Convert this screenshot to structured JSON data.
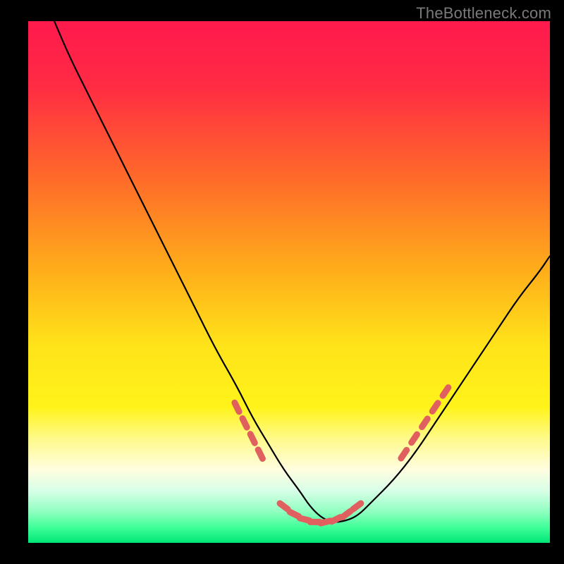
{
  "attribution": "TheBottleneck.com",
  "colors": {
    "background": "#000000",
    "gradient_stops": [
      {
        "offset": 0.0,
        "color": "#ff1a4d"
      },
      {
        "offset": 0.12,
        "color": "#ff2a44"
      },
      {
        "offset": 0.3,
        "color": "#ff6a2a"
      },
      {
        "offset": 0.48,
        "color": "#ffae1a"
      },
      {
        "offset": 0.62,
        "color": "#ffe31a"
      },
      {
        "offset": 0.74,
        "color": "#fff31a"
      },
      {
        "offset": 0.8,
        "color": "#fffa8a"
      },
      {
        "offset": 0.86,
        "color": "#fffde0"
      },
      {
        "offset": 0.9,
        "color": "#d8ffe8"
      },
      {
        "offset": 0.94,
        "color": "#90ffc0"
      },
      {
        "offset": 0.97,
        "color": "#40ff99"
      },
      {
        "offset": 1.0,
        "color": "#00e676"
      }
    ],
    "curve": "#000000",
    "dots": "#e06060",
    "attribution_text": "#7a7a7a"
  },
  "chart_data": {
    "type": "line",
    "title": "",
    "xlabel": "",
    "ylabel": "",
    "xlim": [
      0,
      100
    ],
    "ylim": [
      0,
      100
    ],
    "series": [
      {
        "name": "curve",
        "x": [
          5,
          8,
          12,
          16,
          20,
          24,
          28,
          32,
          36,
          40,
          43,
          46,
          49,
          52,
          54,
          56,
          58,
          60,
          63,
          66,
          70,
          74,
          78,
          82,
          86,
          90,
          94,
          98,
          100
        ],
        "y": [
          100,
          93,
          85,
          77,
          69,
          61,
          53,
          45,
          37,
          30,
          24,
          19,
          14,
          10,
          7,
          5,
          4,
          4,
          5,
          8,
          12,
          17,
          23,
          29,
          35,
          41,
          47,
          52,
          55
        ]
      }
    ],
    "dot_clusters": {
      "left": {
        "x": [
          40,
          41.5,
          43,
          44.5
        ],
        "y": [
          26,
          23,
          20,
          17
        ]
      },
      "floor": {
        "x": [
          49,
          51,
          53,
          55,
          57,
          59,
          61,
          63
        ],
        "y": [
          7,
          5.5,
          4.5,
          4,
          4,
          4.5,
          5.5,
          7
        ]
      },
      "right": {
        "x": [
          72,
          74,
          76,
          78,
          80
        ],
        "y": [
          17,
          20,
          23,
          26,
          29
        ]
      }
    }
  }
}
